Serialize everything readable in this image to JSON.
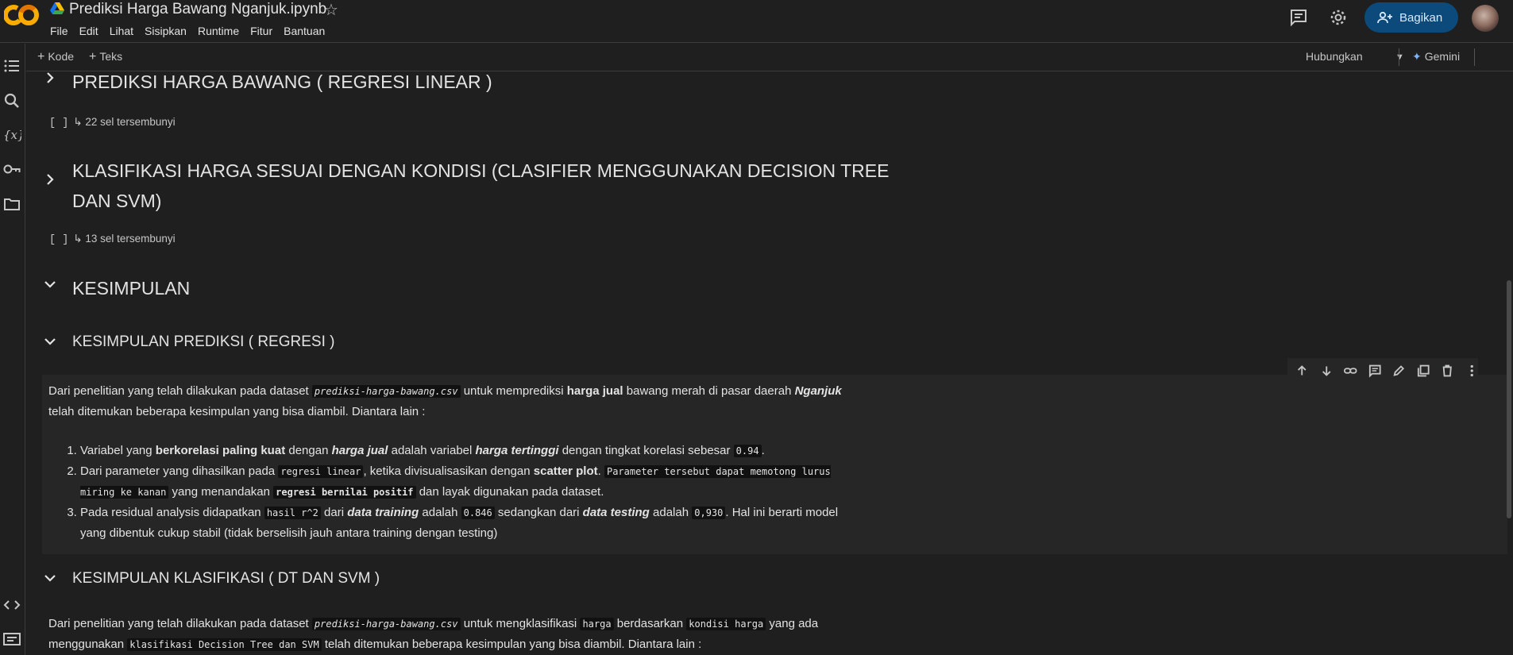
{
  "header": {
    "title": "Prediksi Harga Bawang Nganjuk.ipynb",
    "logo_text": "CO",
    "menu": [
      "File",
      "Edit",
      "Lihat",
      "Sisipkan",
      "Runtime",
      "Fitur",
      "Bantuan"
    ],
    "share_label": "Bagikan"
  },
  "toolbar": {
    "add_code": "Kode",
    "add_text": "Teks",
    "connect_label": "Hubungkan",
    "gemini_label": "Gemini"
  },
  "sections": {
    "s1_title": "PREDIKSI HARGA BAWANG ( REGRESI LINEAR )",
    "s1_hidden": "22 sel tersembunyi",
    "s2_title_line1": "KLASIFIKASI HARGA SESUAI DENGAN KONDISI (CLASIFIER MENGGUNAKAN DECISION TREE",
    "s2_title_line2": "DAN SVM)",
    "s2_hidden": "13 sel tersembunyi",
    "s3_title": "KESIMPULAN",
    "s4_title": "KESIMPULAN PREDIKSI ( REGRESI )",
    "s5_title": "KESIMPULAN KLASIFIKASI ( DT DAN SVM )"
  },
  "cell1": {
    "p_a": "Dari penelitian yang telah dilakukan pada dataset ",
    "p_code": "prediksi-harga-bawang.csv",
    "p_b": " untuk memprediksi ",
    "p_bold": "harga jual",
    "p_c": " bawang merah di pasar daerah ",
    "p_bi": "Nganjuk",
    "p_d": " telah ditemukan beberapa kesimpulan yang bisa diambil. Diantara lain :",
    "li1_a": "Variabel yang ",
    "li1_b": "berkorelasi paling kuat",
    "li1_c": " dengan ",
    "li1_d": "harga jual",
    "li1_e": " adalah variabel ",
    "li1_f": "harga tertinggi",
    "li1_g": " dengan tingkat korelasi sebesar ",
    "li1_code": "0.94",
    "li1_h": ".",
    "li2_a": "Dari parameter yang dihasilkan pada ",
    "li2_code1": "regresi linear",
    "li2_b": ", ketika divisualisasikan dengan ",
    "li2_bold": "scatter plot",
    "li2_c": ". ",
    "li2_code2": "Parameter tersebut dapat memotong lurus miring ke kanan",
    "li2_d": " yang menandakan ",
    "li2_code3": "regresi bernilai positif",
    "li2_e": " dan layak digunakan pada dataset.",
    "li3_a": "Pada residual analysis didapatkan ",
    "li3_code1": "hasil r^2",
    "li3_b": " dari ",
    "li3_bi1": "data training",
    "li3_c": " adalah ",
    "li3_code2": "0.846",
    "li3_d": " sedangkan dari ",
    "li3_bi2": "data testing",
    "li3_e": " adalah ",
    "li3_code3": "0,930",
    "li3_f": ". Hal ini berarti model yang dibentuk cukup stabil (tidak berselisih jauh antara training dengan testing)"
  },
  "cell2": {
    "p_a": "Dari penelitian yang telah dilakukan pada dataset ",
    "p_code1": "prediksi-harga-bawang.csv",
    "p_b": " untuk mengklasifikasi ",
    "p_code2": "harga",
    "p_c": " berdasarkan ",
    "p_code3": "kondisi harga",
    "p_d": " yang ada menggunakan ",
    "p_code4": "klasifikasi Decision Tree dan SVM",
    "p_e": " telah ditemukan beberapa kesimpulan yang bisa diambil. Diantara lain :"
  },
  "colors": {
    "background": "#1f1f1f",
    "cell": "#262626",
    "share_button": "#0b4a7a",
    "accent": "#7ab4ff"
  },
  "icons": [
    "star-icon",
    "comment-icon",
    "gear-icon",
    "share-people-icon",
    "toc-icon",
    "search-icon",
    "variables-icon",
    "key-icon",
    "folder-icon",
    "code-snippets-icon",
    "terminal-icon",
    "chevron-right-icon",
    "chevron-down-icon",
    "arrow-up-icon",
    "arrow-down-icon",
    "link-icon",
    "comment-icon",
    "edit-icon",
    "mirror-icon",
    "delete-icon",
    "more-icon"
  ]
}
